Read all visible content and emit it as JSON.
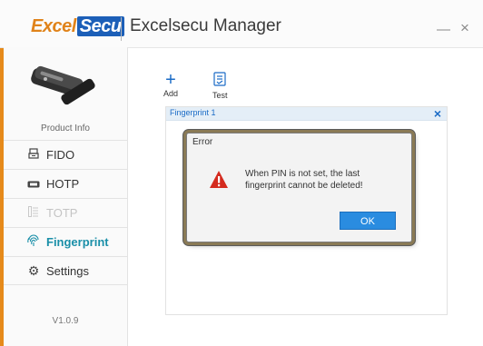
{
  "window": {
    "brand_left": "Excel",
    "brand_right": "Secu",
    "title": "Excelsecu Manager",
    "minimize": "—",
    "close": "×"
  },
  "sidebar": {
    "product_info": "Product Info",
    "items": [
      {
        "label": "FIDO",
        "icon": "fido-icon",
        "state": "normal"
      },
      {
        "label": "HOTP",
        "icon": "hotp-icon",
        "state": "normal"
      },
      {
        "label": "TOTP",
        "icon": "totp-icon",
        "state": "disabled"
      },
      {
        "label": "Fingerprint",
        "icon": "fingerprint-icon",
        "state": "active"
      },
      {
        "label": "Settings",
        "icon": "settings-icon",
        "state": "normal"
      }
    ],
    "version": "V1.0.9"
  },
  "toolbar": {
    "add_label": "Add",
    "test_label": "Test"
  },
  "fingerprint_panel": {
    "title": "Fingerprint 1",
    "close": "×"
  },
  "dialog": {
    "title": "Error",
    "message": "When PIN is not set, the last fingerprint cannot be deleted!",
    "ok_label": "OK"
  },
  "colors": {
    "accent_blue": "#1a6bc6",
    "active_teal": "#1a8fa8",
    "warning_red": "#d42a1e",
    "brand_orange": "#e0831a"
  }
}
